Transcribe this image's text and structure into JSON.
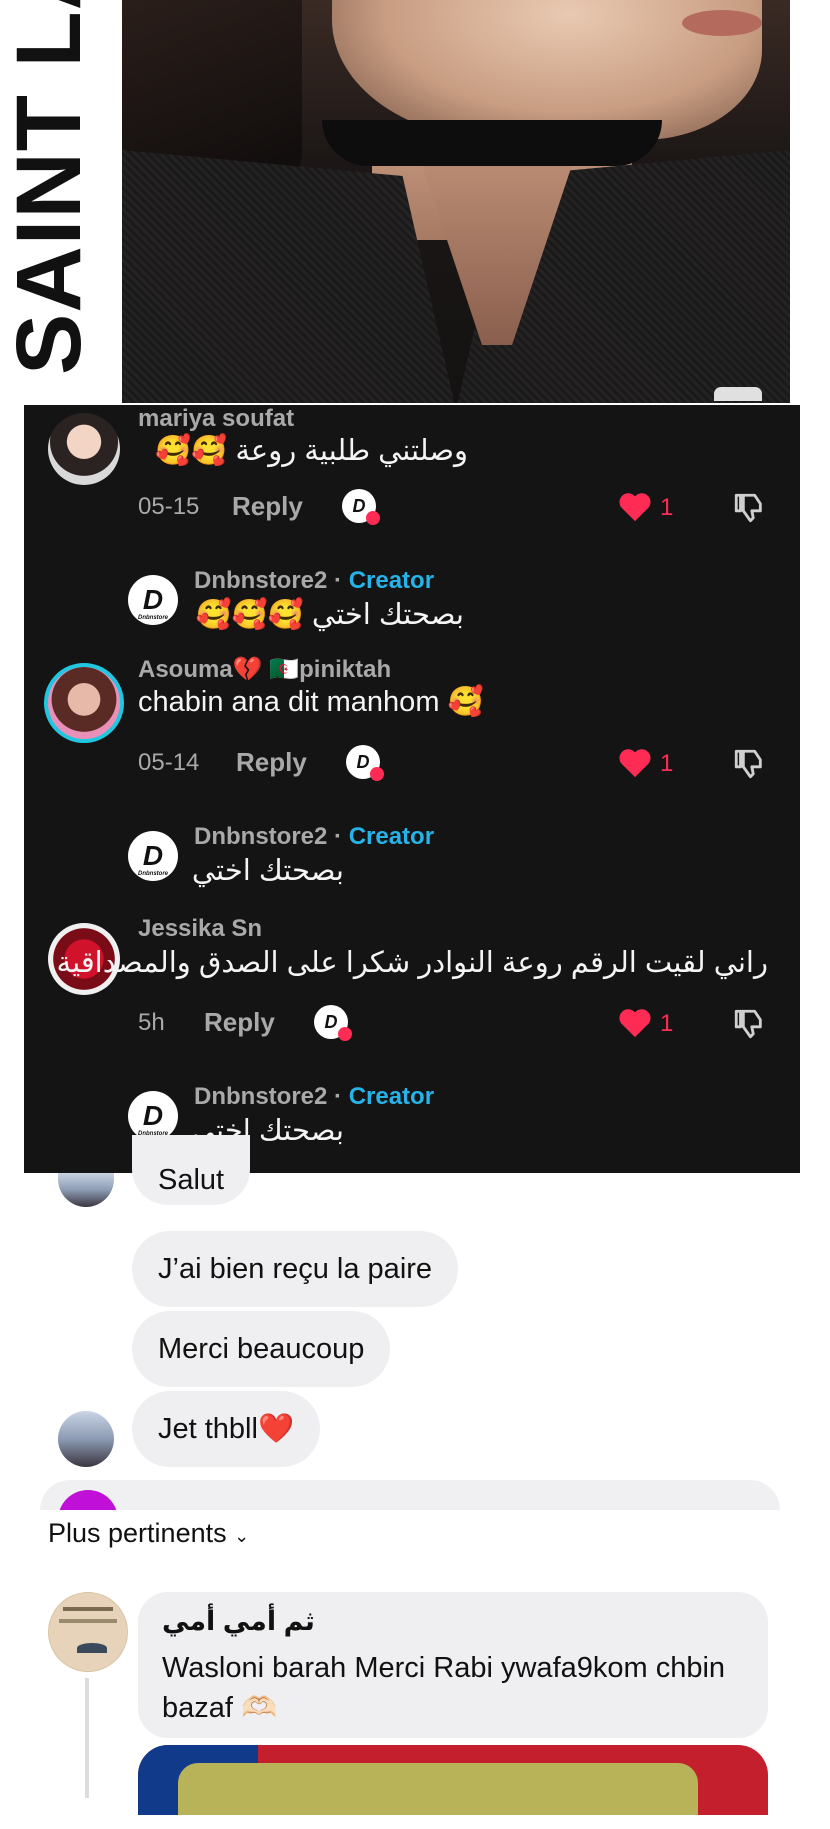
{
  "photo": {
    "brand_text": "SAINT LA"
  },
  "tiktok_comments": [
    {
      "name": "mariya soufat",
      "text": "وصلتني طلبية روعة 🥰🥰",
      "date": "05-15",
      "reply": "Reply",
      "likes": "1"
    },
    {
      "name": "Asouma💔 🇩🇿piniktah",
      "text": "chabin ana dit manhom 🥰",
      "date": "05-14",
      "reply": "Reply",
      "likes": "1"
    },
    {
      "name": "Jessika Sn",
      "text": "راني لقيت الرقم روعة النوادر شكرا على الصدق والمصداقية",
      "date": "5h",
      "reply": "Reply",
      "likes": "1"
    }
  ],
  "creator_replies": [
    {
      "name": "Dnbnstore2",
      "separator": " · ",
      "badge": "Creator",
      "text": "بصحتك اختي 🥰🥰🥰"
    },
    {
      "name": "Dnbnstore2",
      "separator": " · ",
      "badge": "Creator",
      "text": "بصحتك اختي"
    },
    {
      "name": "Dnbnstore2",
      "separator": " · ",
      "badge": "Creator",
      "text": "بصحتك اختي"
    }
  ],
  "messenger": {
    "messages": [
      "Salut",
      "J’ai bien reçu la paire",
      "Merci beaucoup",
      "Jet thbll❤️"
    ]
  },
  "facebook": {
    "sort_label": "Plus pertinents",
    "comment": {
      "name": "ثم أمي أمي",
      "text": "Wasloni barah Merci Rabi ywafa9kom chbin bazaf 🫶🏻"
    }
  },
  "colors": {
    "like": "#fe2c55",
    "creator": "#25b3e8",
    "dark_bg": "#141414"
  }
}
